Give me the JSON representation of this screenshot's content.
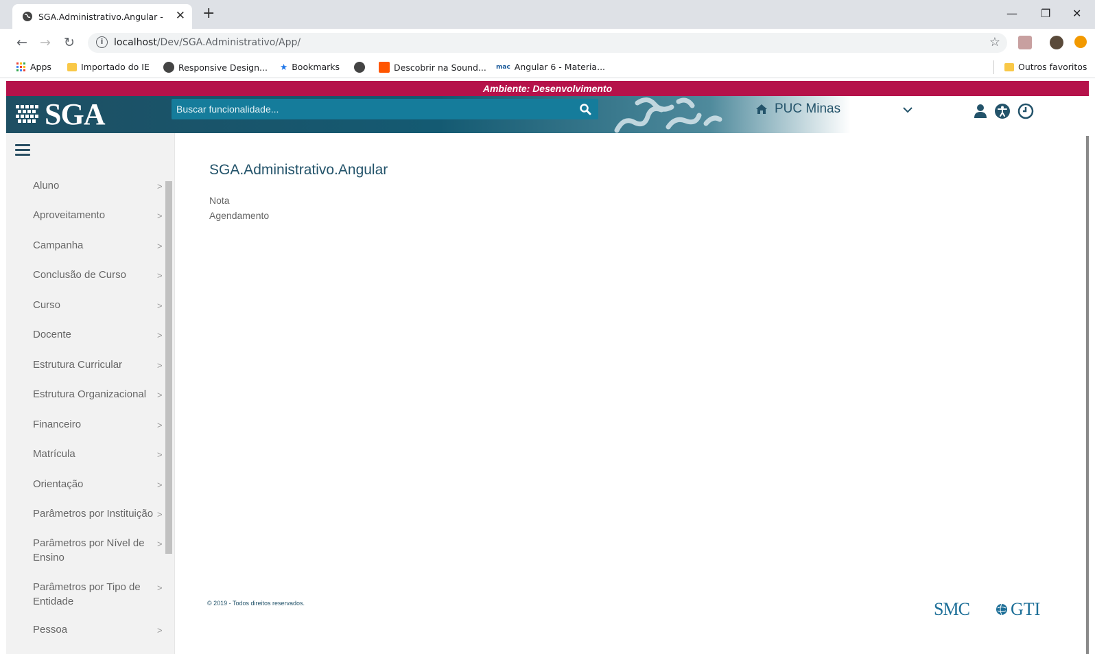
{
  "browser": {
    "tab_title": "SGA.Administrativo.Angular -",
    "url_host": "localhost",
    "url_path": "/Dev/SGA.Administrativo/App/",
    "bookmarks": [
      "Apps",
      "Importado do IE",
      "Responsive Design...",
      "Bookmarks",
      "Descobrir na Sound...",
      "Angular 6 - Materia..."
    ],
    "other_bookmarks": "Outros favoritos"
  },
  "app": {
    "environment_banner": "Ambiente: Desenvolvimento",
    "logo_text": "SGA",
    "search_placeholder": "Buscar funcionalidade...",
    "institution": "PUC Minas",
    "colors": {
      "banner": "#b5124a",
      "header": "#1e4f63",
      "accent": "#23536a"
    }
  },
  "sidebar": {
    "items": [
      {
        "label": "Aluno"
      },
      {
        "label": "Aproveitamento"
      },
      {
        "label": "Campanha"
      },
      {
        "label": "Conclusão de Curso"
      },
      {
        "label": "Curso"
      },
      {
        "label": "Docente"
      },
      {
        "label": "Estrutura Curricular"
      },
      {
        "label": "Estrutura Organizacional"
      },
      {
        "label": "Financeiro"
      },
      {
        "label": "Matrícula"
      },
      {
        "label": "Orientação"
      },
      {
        "label": "Parâmetros por Instituição"
      },
      {
        "label": "Parâmetros por Nível de Ensino"
      },
      {
        "label": "Parâmetros por Tipo de Entidade"
      },
      {
        "label": "Pessoa"
      }
    ]
  },
  "main": {
    "title": "SGA.Administrativo.Angular",
    "links": [
      "Nota",
      "Agendamento"
    ]
  },
  "footer": {
    "copyright": "© 2019 - Todos direitos reservados.",
    "logo_smc": "SMC",
    "logo_gti": "GTI"
  }
}
